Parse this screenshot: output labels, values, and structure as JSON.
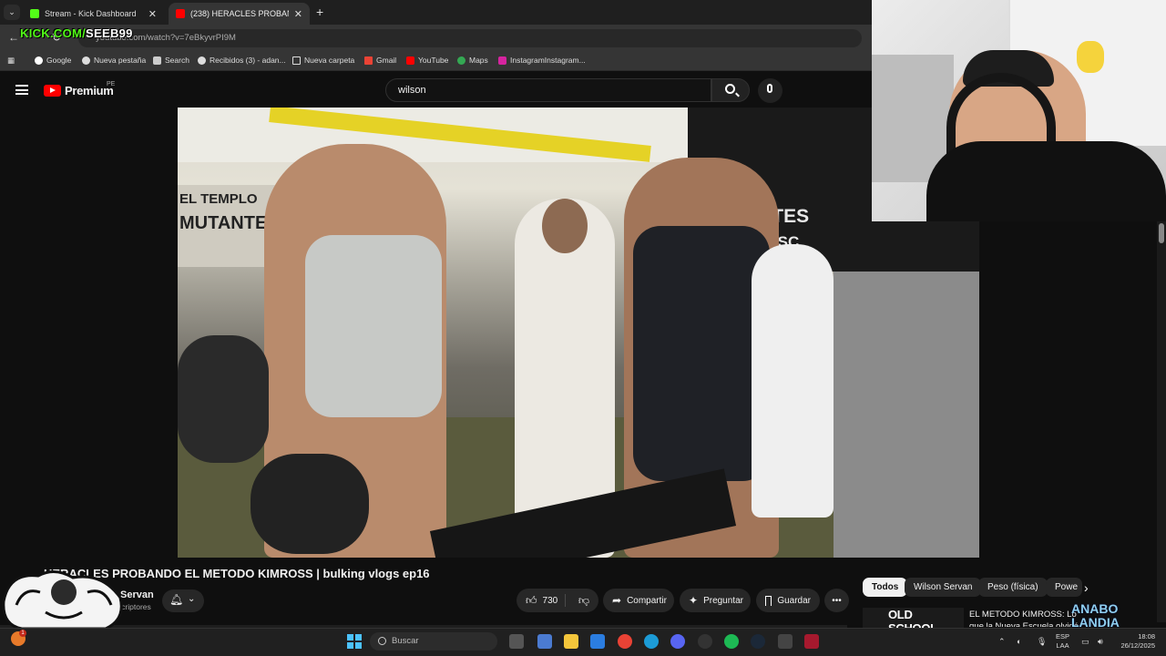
{
  "browser": {
    "tabs": [
      {
        "title": "Stream - Kick Dashboard",
        "close": "✕"
      },
      {
        "title": "(238) HERACLES PROBANDO E",
        "close": "✕"
      }
    ],
    "new_tab": "+",
    "url": "youtube.com/watch?v=7eBkyvrPI9M",
    "kick_overlay_green": "KICK.COM/",
    "kick_overlay_white": "SEEB99",
    "bookmarks": [
      "Google",
      "Nueva pestaña",
      "Search",
      "Recibidos (3) - adan...",
      "Nueva carpeta",
      "Gmail",
      "YouTube",
      "Maps",
      "InstagramInstagram..."
    ]
  },
  "youtube": {
    "logo": "Premium",
    "region": "PE",
    "search_value": "wilson",
    "video": {
      "title": "HERACLES PROBANDO EL METODO KIMROSS | bulking vlogs ep16",
      "channel": "Wilson Servan",
      "subscribers": "22,9 K suscriptores",
      "likes": "730",
      "share": "Compartir",
      "ask": "Preguntar",
      "save": "Guardar",
      "more": "•••",
      "scene_text": [
        "EL TEMPLO",
        "MUTANTES",
        "MUTANTES",
        "OLD SC"
      ]
    },
    "chips": [
      "Todos",
      "Wilson Servan",
      "Peso (física)",
      "Powe"
    ],
    "recommendation": {
      "thumb_text": "OLD SCHOOL",
      "title": "EL METODO KIMROSS: Lo que la Nueva Escuela olvidó"
    },
    "corner_logo": [
      "ANABO",
      "LANDIA"
    ]
  },
  "taskbar": {
    "search_placeholder": "Buscar",
    "lang_line1": "ESP",
    "lang_line2": "LAA",
    "time": "18:08",
    "date": "26/12/2025"
  },
  "colors": {
    "kick_green": "#53fc18",
    "youtube_red": "#ff0000",
    "background": "#0f0f0f"
  }
}
